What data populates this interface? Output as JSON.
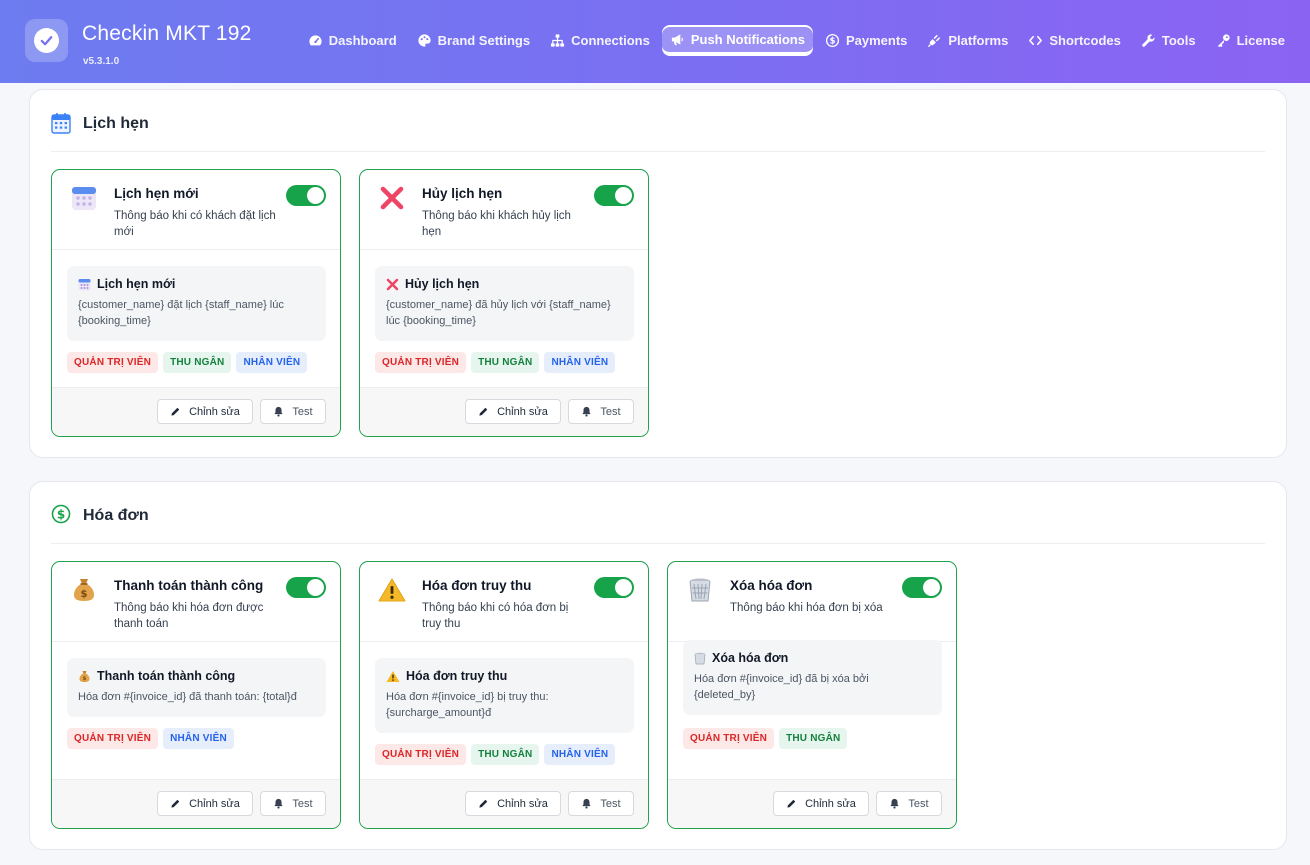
{
  "app": {
    "title": "Checkin MKT 192",
    "version": "v5.3.1.0"
  },
  "nav": [
    {
      "label": "Dashboard",
      "icon": "gauge-icon",
      "active": false
    },
    {
      "label": "Brand Settings",
      "icon": "palette-icon",
      "active": false
    },
    {
      "label": "Connections",
      "icon": "sitemap-icon",
      "active": false
    },
    {
      "label": "Push Notifications",
      "icon": "bullhorn-icon",
      "active": true
    },
    {
      "label": "Payments",
      "icon": "dollar-icon",
      "active": false
    },
    {
      "label": "Platforms",
      "icon": "plug-icon",
      "active": false
    },
    {
      "label": "Shortcodes",
      "icon": "code-icon",
      "active": false
    },
    {
      "label": "Tools",
      "icon": "wrench-icon",
      "active": false
    },
    {
      "label": "License",
      "icon": "key-icon",
      "active": false
    }
  ],
  "labels": {
    "edit": "Chỉnh sửa",
    "test": "Test",
    "admin": "QUẢN TRỊ VIÊN",
    "cashier": "THU NGÂN",
    "staff": "NHÂN VIÊN"
  },
  "sections": [
    {
      "title": "Lịch hẹn",
      "icon": "calendar-icon",
      "cards": [
        {
          "title": "Lịch hẹn mới",
          "desc": "Thông báo khi có khách đặt lịch mới",
          "icon": "calendar-icon",
          "enabled": true,
          "preview_title": "Lịch hẹn mới",
          "preview_body": "{customer_name} đặt lịch {staff_name} lúc {booking_time}",
          "roles": [
            "admin",
            "cashier",
            "staff"
          ]
        },
        {
          "title": "Hủy lịch hẹn",
          "desc": "Thông báo khi khách hủy lịch hẹn",
          "icon": "cross-mark-icon",
          "enabled": true,
          "preview_title": "Hủy lịch hẹn",
          "preview_body": "{customer_name} đã hủy lịch với {staff_name} lúc {booking_time}",
          "roles": [
            "admin",
            "cashier",
            "staff"
          ]
        }
      ]
    },
    {
      "title": "Hóa đơn",
      "icon": "dollar-circle-icon",
      "cards": [
        {
          "title": "Thanh toán thành công",
          "desc": "Thông báo khi hóa đơn được thanh toán",
          "icon": "money-bag-icon",
          "enabled": true,
          "preview_title": "Thanh toán thành công",
          "preview_body": "Hóa đơn #{invoice_id} đã thanh toán: {total}đ",
          "roles": [
            "admin",
            "staff"
          ]
        },
        {
          "title": "Hóa đơn truy thu",
          "desc": "Thông báo khi có hóa đơn bị truy thu",
          "icon": "warning-icon",
          "enabled": true,
          "preview_title": "Hóa đơn truy thu",
          "preview_body": "Hóa đơn #{invoice_id} bị truy thu: {surcharge_amount}đ",
          "roles": [
            "admin",
            "cashier",
            "staff"
          ]
        },
        {
          "title": "Xóa hóa đơn",
          "desc": "Thông báo khi hóa đơn bị xóa",
          "icon": "wastebasket-icon",
          "enabled": true,
          "preview_title": "Xóa hóa đơn",
          "preview_body": "Hóa đơn #{invoice_id} đã bị xóa bởi {deleted_by}",
          "roles": [
            "admin",
            "cashier"
          ]
        }
      ]
    }
  ]
}
